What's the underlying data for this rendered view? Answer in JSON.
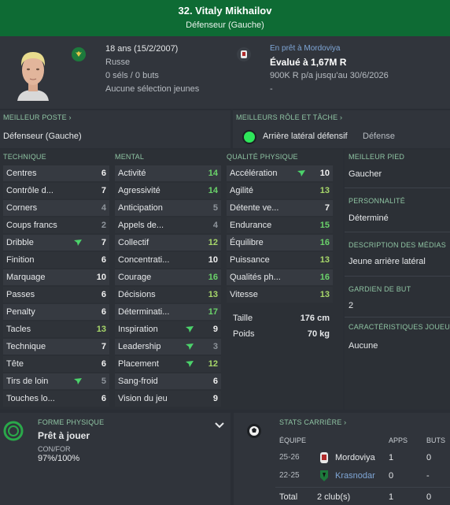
{
  "header": {
    "player_name": "32. Vitaly Mikhailov",
    "position": "Défenseur (Gauche)"
  },
  "profile": {
    "age_dob": "18 ans (15/2/2007)",
    "nationality": "Russe",
    "caps": "0 séls / 0 buts",
    "youth_caps": "Aucune sélection jeunes",
    "loan_status": "En prêt à Mordoviya",
    "value": "Évalué à 1,67M R",
    "contract": "900K R p/a jusqu'au 30/6/2026",
    "contract_extra": "-"
  },
  "best_position": {
    "label": "MEILLEUR POSTE",
    "value": "Défenseur (Gauche)"
  },
  "best_role": {
    "label": "MEILLEURS RÔLE ET TÂCHE",
    "role": "Arrière latéral défensif",
    "duty": "Défense"
  },
  "technique": {
    "label": "TECHNIQUE",
    "items": [
      {
        "name": "Centres",
        "value": "6",
        "color": "white",
        "arrow": false
      },
      {
        "name": "Contrôle d...",
        "value": "7",
        "color": "white",
        "arrow": false
      },
      {
        "name": "Corners",
        "value": "4",
        "color": "grey",
        "arrow": false
      },
      {
        "name": "Coups francs",
        "value": "2",
        "color": "grey",
        "arrow": false
      },
      {
        "name": "Dribble",
        "value": "7",
        "color": "white",
        "arrow": true
      },
      {
        "name": "Finition",
        "value": "6",
        "color": "white",
        "arrow": false
      },
      {
        "name": "Marquage",
        "value": "10",
        "color": "white",
        "arrow": false
      },
      {
        "name": "Passes",
        "value": "6",
        "color": "white",
        "arrow": false
      },
      {
        "name": "Penalty",
        "value": "6",
        "color": "white",
        "arrow": false
      },
      {
        "name": "Tacles",
        "value": "13",
        "color": "lgreen",
        "arrow": false
      },
      {
        "name": "Technique",
        "value": "7",
        "color": "white",
        "arrow": false
      },
      {
        "name": "Tête",
        "value": "6",
        "color": "white",
        "arrow": false
      },
      {
        "name": "Tirs de loin",
        "value": "5",
        "color": "grey",
        "arrow": true
      },
      {
        "name": "Touches lo...",
        "value": "6",
        "color": "white",
        "arrow": false
      }
    ]
  },
  "mental": {
    "label": "MENTAL",
    "items": [
      {
        "name": "Activité",
        "value": "14",
        "color": "green",
        "arrow": false
      },
      {
        "name": "Agressivité",
        "value": "14",
        "color": "green",
        "arrow": false
      },
      {
        "name": "Anticipation",
        "value": "5",
        "color": "grey",
        "arrow": false
      },
      {
        "name": "Appels de...",
        "value": "4",
        "color": "grey",
        "arrow": false
      },
      {
        "name": "Collectif",
        "value": "12",
        "color": "lgreen",
        "arrow": false
      },
      {
        "name": "Concentrati...",
        "value": "10",
        "color": "white",
        "arrow": false
      },
      {
        "name": "Courage",
        "value": "16",
        "color": "green",
        "arrow": false
      },
      {
        "name": "Décisions",
        "value": "13",
        "color": "lgreen",
        "arrow": false
      },
      {
        "name": "Déterminati...",
        "value": "17",
        "color": "green",
        "arrow": false
      },
      {
        "name": "Inspiration",
        "value": "9",
        "color": "white",
        "arrow": true
      },
      {
        "name": "Leadership",
        "value": "3",
        "color": "grey",
        "arrow": true
      },
      {
        "name": "Placement",
        "value": "12",
        "color": "lgreen",
        "arrow": true
      },
      {
        "name": "Sang-froid",
        "value": "6",
        "color": "white",
        "arrow": false
      },
      {
        "name": "Vision du jeu",
        "value": "9",
        "color": "white",
        "arrow": false
      }
    ]
  },
  "physical": {
    "label": "QUALITÉ PHYSIQUE",
    "items": [
      {
        "name": "Accélération",
        "value": "10",
        "color": "white",
        "arrow": true
      },
      {
        "name": "Agilité",
        "value": "13",
        "color": "lgreen",
        "arrow": false
      },
      {
        "name": "Détente ve...",
        "value": "7",
        "color": "white",
        "arrow": false
      },
      {
        "name": "Endurance",
        "value": "15",
        "color": "green",
        "arrow": false
      },
      {
        "name": "Équilibre",
        "value": "16",
        "color": "green",
        "arrow": false
      },
      {
        "name": "Puissance",
        "value": "13",
        "color": "lgreen",
        "arrow": false
      },
      {
        "name": "Qualités ph...",
        "value": "16",
        "color": "green",
        "arrow": false
      },
      {
        "name": "Vitesse",
        "value": "13",
        "color": "lgreen",
        "arrow": false
      }
    ],
    "height_label": "Taille",
    "height_value": "176 cm",
    "weight_label": "Poids",
    "weight_value": "70 kg"
  },
  "right_panel": {
    "best_foot_label": "MEILLEUR PIED",
    "best_foot": "Gaucher",
    "personality_label": "PERSONNALITÉ",
    "personality": "Déterminé",
    "media_label": "DESCRIPTION DES MÉDIAS",
    "media": "Jeune arrière latéral",
    "goalkeeper_label": "GARDIEN DE BUT",
    "goalkeeper": "2",
    "traits_label": "CARACTÉRISTIQUES JOUEUR",
    "traits": "Aucune"
  },
  "fitness": {
    "label": "FORME PHYSIQUE",
    "status": "Prêt à jouer",
    "cond_label": "CON/FOR",
    "cond_value": "97%/100%"
  },
  "career": {
    "label": "STATS CARRIÈRE",
    "col_team": "ÉQUIPE",
    "col_apps": "APPS",
    "col_goals": "BUTS",
    "rows": [
      {
        "season": "25-26",
        "team": "Mordoviya",
        "apps": "1",
        "goals": "0"
      },
      {
        "season": "22-25",
        "team": "Krasnodar",
        "apps": "0",
        "goals": "-"
      }
    ],
    "total_label": "Total",
    "total_clubs": "2 club(s)",
    "total_apps": "1",
    "total_goals": "0"
  },
  "colors": {
    "header": "#0e6b34",
    "green": "#4cd36b",
    "attr_green": "#6ad26a",
    "attr_lgreen": "#a8d86a",
    "attr_grey": "#8e949b"
  }
}
